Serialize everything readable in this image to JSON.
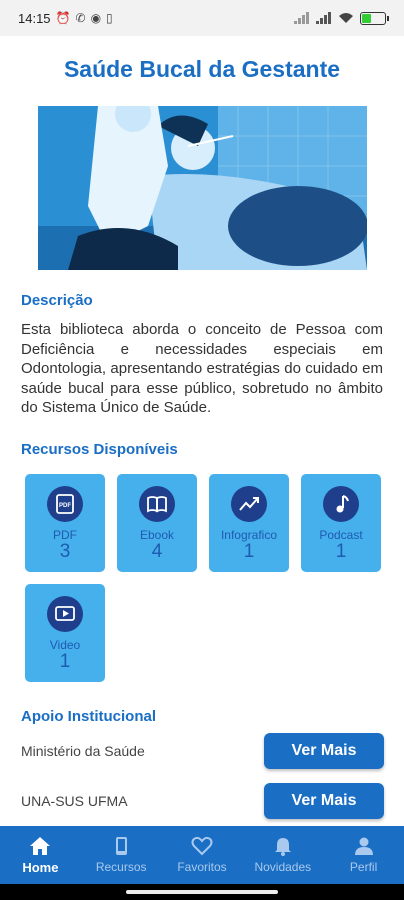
{
  "status_bar": {
    "time": "14:15",
    "battery_level": 0.4
  },
  "page": {
    "title": "Saúde Bucal da Gestante"
  },
  "description": {
    "heading": "Descrição",
    "text": "Esta biblioteca aborda o conceito de Pessoa com Deficiência e necessidades especiais em Odontologia, apresentando estratégias do cuidado em saúde bucal para esse público, sobretudo no âmbito do Sistema Único de Saúde."
  },
  "resources": {
    "heading": "Recursos Disponíveis",
    "items": [
      {
        "label": "PDF",
        "count": "3",
        "icon": "pdf-icon"
      },
      {
        "label": "Ebook",
        "count": "4",
        "icon": "book-icon"
      },
      {
        "label": "Infografico",
        "count": "1",
        "icon": "chart-icon"
      },
      {
        "label": "Podcast",
        "count": "1",
        "icon": "music-note-icon"
      },
      {
        "label": "Video",
        "count": "1",
        "icon": "video-icon"
      }
    ]
  },
  "support": {
    "heading": "Apoio Institucional",
    "items": [
      {
        "name": "Ministério da Saúde",
        "button": "Ver Mais"
      },
      {
        "name": "UNA-SUS UFMA",
        "button": "Ver Mais"
      }
    ]
  },
  "bottom_nav": {
    "items": [
      {
        "label": "Home",
        "icon": "home-icon",
        "active": true
      },
      {
        "label": "Recursos",
        "icon": "device-icon",
        "active": false
      },
      {
        "label": "Favoritos",
        "icon": "heart-icon",
        "active": false
      },
      {
        "label": "Novidades",
        "icon": "bell-icon",
        "active": false
      },
      {
        "label": "Perfil",
        "icon": "person-icon",
        "active": false
      }
    ]
  },
  "colors": {
    "primary": "#1a6ec4",
    "card": "#45b0ec",
    "icon_circle": "#1f3f8c"
  }
}
